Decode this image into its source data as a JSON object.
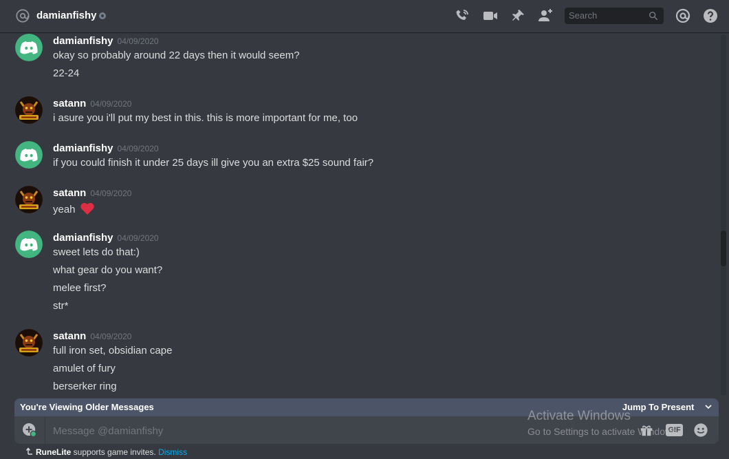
{
  "header": {
    "channel_icon": "at-icon",
    "username": "damianfishy",
    "status": "offline",
    "icons": [
      "voice-call-icon",
      "video-call-icon",
      "pin-icon",
      "add-friend-icon",
      "mentions-icon",
      "help-icon"
    ],
    "search_placeholder": "Search"
  },
  "messages": [
    {
      "author": "damianfishy",
      "avatar": "discord-logo",
      "timestamp": "04/09/2020",
      "lines": [
        "okay so probably around 22 days then it would seem?",
        "22-24"
      ]
    },
    {
      "author": "satann",
      "avatar": "satann-avatar",
      "timestamp": "04/09/2020",
      "lines": [
        "i asure you i'll put my best in this. this is more important for me, too"
      ]
    },
    {
      "author": "damianfishy",
      "avatar": "discord-logo",
      "timestamp": "04/09/2020",
      "lines": [
        "if you could finish it under 25 days ill give you an extra $25 sound fair?"
      ]
    },
    {
      "author": "satann",
      "avatar": "satann-avatar",
      "timestamp": "04/09/2020",
      "lines": [
        "yeah"
      ],
      "emoji": "heart-emoji"
    },
    {
      "author": "damianfishy",
      "avatar": "discord-logo",
      "timestamp": "04/09/2020",
      "lines": [
        "sweet lets do that:)",
        "what gear do you want?",
        "melee first?",
        "str*"
      ]
    },
    {
      "author": "satann",
      "avatar": "satann-avatar",
      "timestamp": "04/09/2020",
      "lines": [
        "full iron set, obsidian cape",
        "amulet of fury",
        "berserker ring"
      ]
    }
  ],
  "older_bar": {
    "label": "You're Viewing Older Messages",
    "jump_label": "Jump To Present"
  },
  "composer": {
    "placeholder": "Message @damianfishy",
    "gif_label": "GIF"
  },
  "watermark": {
    "title": "Activate Windows",
    "subtitle": "Go to Settings to activate Windows."
  },
  "footer": {
    "app": "RuneLite",
    "text": " supports game invites.",
    "dismiss": "Dismiss"
  },
  "colors": {
    "background": "#36393f",
    "discord_green": "#43b581",
    "heart": "#dd2e44",
    "link": "#00b0f4"
  }
}
